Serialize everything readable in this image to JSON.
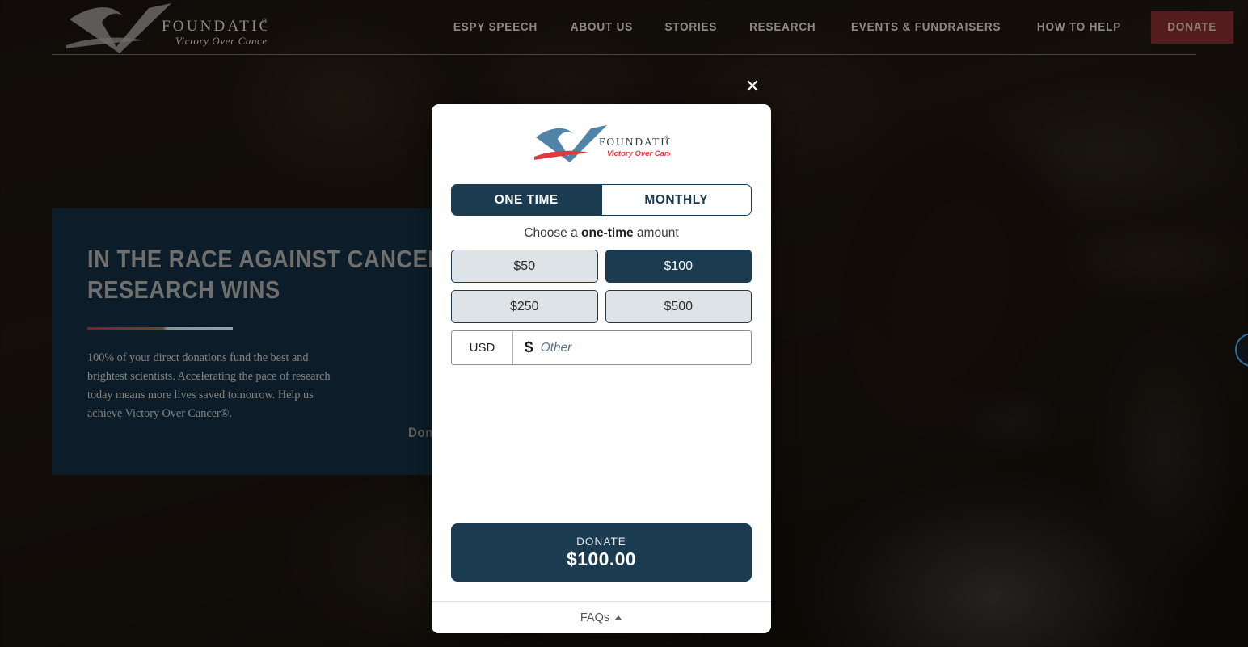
{
  "header": {
    "logo": {
      "name": "FOUNDATION",
      "registered_mark": "®",
      "tagline": "Victory Over Cancer"
    },
    "nav_items": [
      {
        "label": "ESPY SPEECH"
      },
      {
        "label": "ABOUT US"
      },
      {
        "label": "STORIES"
      },
      {
        "label": "RESEARCH"
      },
      {
        "label": "EVENTS & FUNDRAISERS"
      },
      {
        "label": "HOW TO HELP"
      }
    ],
    "donate_button": "DONATE",
    "menu_icon": "hamburger-menu-icon"
  },
  "hero": {
    "title": "In the race against cancer, research wins",
    "body": "100% of your direct donations fund the best and brightest scientists. Accelerating the pace of research today means more lives saved tomorrow. Help us achieve Victory Over Cancer®.",
    "cta": "Donate Today"
  },
  "modal": {
    "close_icon": "✕",
    "logo": {
      "name": "FOUNDATION",
      "registered_mark": "®",
      "tagline": "Victory Over Cancer"
    },
    "frequency": {
      "one_time": "ONE TIME",
      "monthly": "MONTHLY",
      "selected": "ONE TIME"
    },
    "prompt": {
      "prefix": "Choose a ",
      "emphasis": "one-time",
      "suffix": " amount"
    },
    "amounts": [
      {
        "label": "$50",
        "value": 50,
        "selected": false
      },
      {
        "label": "$100",
        "value": 100,
        "selected": true
      },
      {
        "label": "$250",
        "value": 250,
        "selected": false
      },
      {
        "label": "$500",
        "value": 500,
        "selected": false
      }
    ],
    "other_amount": {
      "currency": "USD",
      "symbol": "$",
      "placeholder": "Other",
      "value": ""
    },
    "submit": {
      "label": "DONATE",
      "amount": "$100.00"
    },
    "footer": {
      "faq_label": "FAQs",
      "caret_icon": "caret-up-icon"
    }
  },
  "colors": {
    "navy": "#1b3b50",
    "hero_panel": "#0c1d29",
    "donate_nav_red": "#541c1c",
    "logo_blue": "#4f84a8",
    "logo_red": "#e03a3e",
    "unselected_amount": "#dde3e7"
  }
}
